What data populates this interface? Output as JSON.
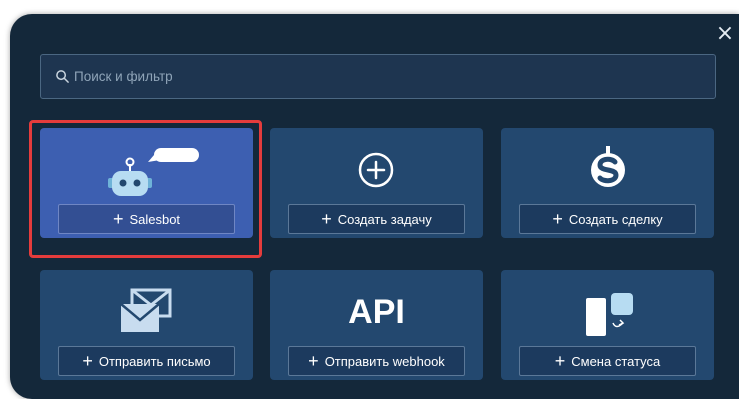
{
  "search": {
    "placeholder": "Поиск и фильтр"
  },
  "tiles": [
    {
      "label": "Salesbot",
      "icon": "robot-chat-icon",
      "selected": true
    },
    {
      "label": "Создать задачу",
      "icon": "circle-plus-icon"
    },
    {
      "label": "Создать сделку",
      "icon": "dollar-icon"
    },
    {
      "label": "Отправить письмо",
      "icon": "envelope-icon"
    },
    {
      "label": "Отправить webhook",
      "icon": "api-icon",
      "icon_text": "API"
    },
    {
      "label": "Смена статуса",
      "icon": "status-change-icon"
    }
  ],
  "colors": {
    "background": "#14283a",
    "tile": "#23486f",
    "tile_selected": "#3d5fb1",
    "selection_outline": "#e53c3c"
  }
}
